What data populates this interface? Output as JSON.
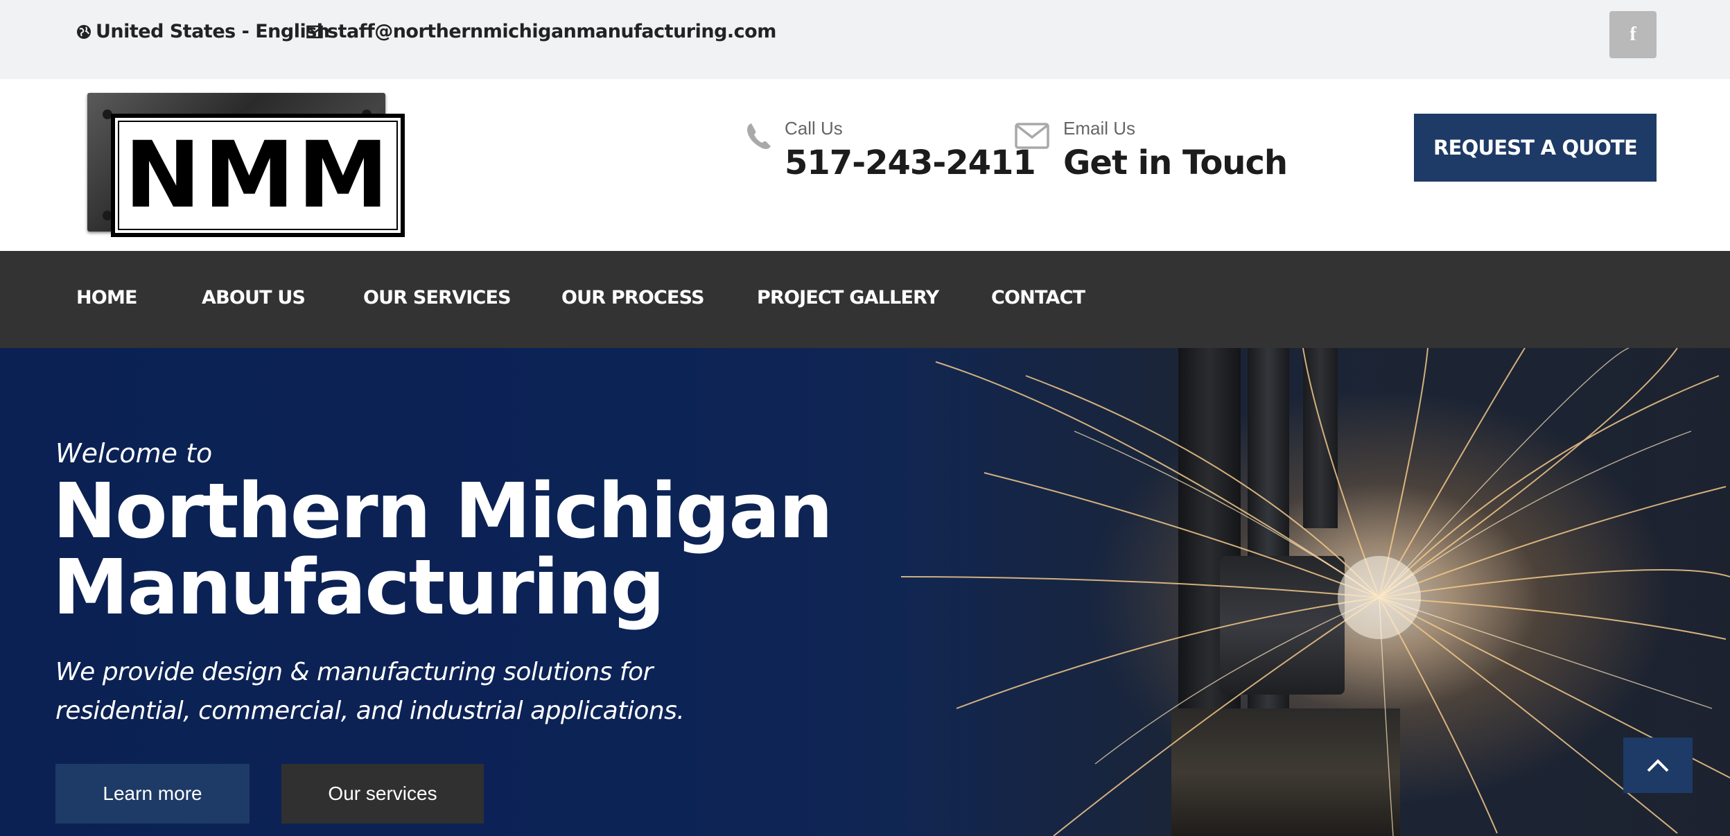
{
  "topbar": {
    "language": "United States - English",
    "email": "staff@northernmichiganmanufacturing.com",
    "facebook_label": "f"
  },
  "header": {
    "logo_text": "NMM",
    "call": {
      "label": "Call Us",
      "value": "517-243-2411"
    },
    "email": {
      "label": "Email Us",
      "value": "Get in Touch"
    },
    "quote_button": "REQUEST A QUOTE"
  },
  "nav": {
    "items": [
      {
        "label": "HOME"
      },
      {
        "label": "ABOUT US"
      },
      {
        "label": "OUR SERVICES"
      },
      {
        "label": "OUR PROCESS"
      },
      {
        "label": "PROJECT GALLERY"
      },
      {
        "label": "CONTACT"
      }
    ]
  },
  "hero": {
    "welcome": "Welcome to",
    "title_line1": "Northern Michigan",
    "title_line2": "Manufacturing",
    "subtitle_line1": "We provide design & manufacturing solutions for",
    "subtitle_line2": "residential, commercial, and industrial applications.",
    "learn_more": "Learn more",
    "our_services": "Our services"
  },
  "colors": {
    "brand_navy": "#1e3a66",
    "nav_bg": "#333333",
    "topbar_bg": "#f1f2f4"
  },
  "icons": [
    "globe-icon",
    "envelope-icon",
    "facebook-icon",
    "phone-icon",
    "mail-outline-icon",
    "chevron-up-icon"
  ]
}
